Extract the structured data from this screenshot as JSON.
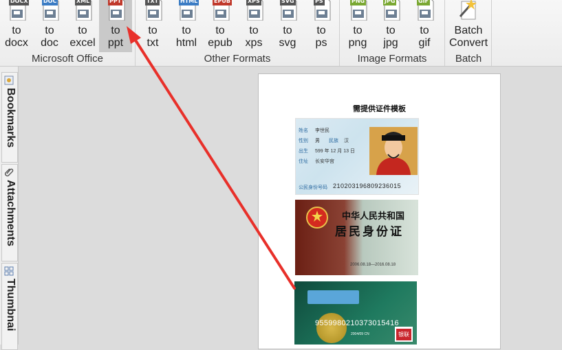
{
  "ribbon": {
    "groups": [
      {
        "label": "Microsoft Office",
        "buttons": [
          {
            "tag": "DOCX",
            "l1": "to",
            "l2": "docx",
            "color": "#555555"
          },
          {
            "tag": "DOC",
            "l1": "to",
            "l2": "doc",
            "color": "#3b7cc4"
          },
          {
            "tag": "XML",
            "l1": "to",
            "l2": "excel",
            "color": "#555555"
          },
          {
            "tag": "PPT",
            "l1": "to",
            "l2": "ppt",
            "color": "#c0392b"
          }
        ]
      },
      {
        "label": "Other Formats",
        "buttons": [
          {
            "tag": "TXT",
            "l1": "to",
            "l2": "txt",
            "color": "#555555"
          },
          {
            "tag": "HTML",
            "l1": "to",
            "l2": "html",
            "color": "#3b7cc4"
          },
          {
            "tag": "EPUB",
            "l1": "to",
            "l2": "epub",
            "color": "#c0392b"
          },
          {
            "tag": "XPS",
            "l1": "to",
            "l2": "xps",
            "color": "#555555"
          },
          {
            "tag": "SVG",
            "l1": "to",
            "l2": "svg",
            "color": "#555555"
          },
          {
            "tag": "PS",
            "l1": "to",
            "l2": "ps",
            "color": "#555555"
          }
        ]
      },
      {
        "label": "Image Formats",
        "buttons": [
          {
            "tag": "PNG",
            "l1": "to",
            "l2": "png",
            "color": "#7aa832"
          },
          {
            "tag": "JPG",
            "l1": "to",
            "l2": "jpg",
            "color": "#7aa832"
          },
          {
            "tag": "GIF",
            "l1": "to",
            "l2": "gif",
            "color": "#7aa832"
          }
        ]
      },
      {
        "label": "Batch",
        "buttons": [
          {
            "tag": "",
            "l1": "Batch",
            "l2": "Convert",
            "color": "#e0a020"
          }
        ]
      }
    ]
  },
  "sidebar": {
    "tabs": [
      "Bookmarks",
      "Attachments",
      "Thumbnai"
    ]
  },
  "document": {
    "title": "需提供证件模板",
    "card1": {
      "name_label": "姓名",
      "name_value": "李世民",
      "sex_label": "性别",
      "sex_value": "男",
      "nation_label": "民族",
      "nation_value": "汉",
      "birth_label": "出生",
      "birth_value": "599 年 12 月 13 日",
      "addr_label": "住址",
      "addr_value": "长安华宫",
      "id_label": "公民身份号码",
      "id_number": "210203196809236015"
    },
    "card2": {
      "country": "中华人民共和国",
      "type": "居民身份证",
      "valid": "2006.08.18—2016.08.18"
    },
    "card3": {
      "number": "9559980210373015416",
      "valid": "2004/09 CN"
    }
  },
  "colors": {
    "arrow": "#e8302a",
    "active_button": "#c9c9c9"
  }
}
